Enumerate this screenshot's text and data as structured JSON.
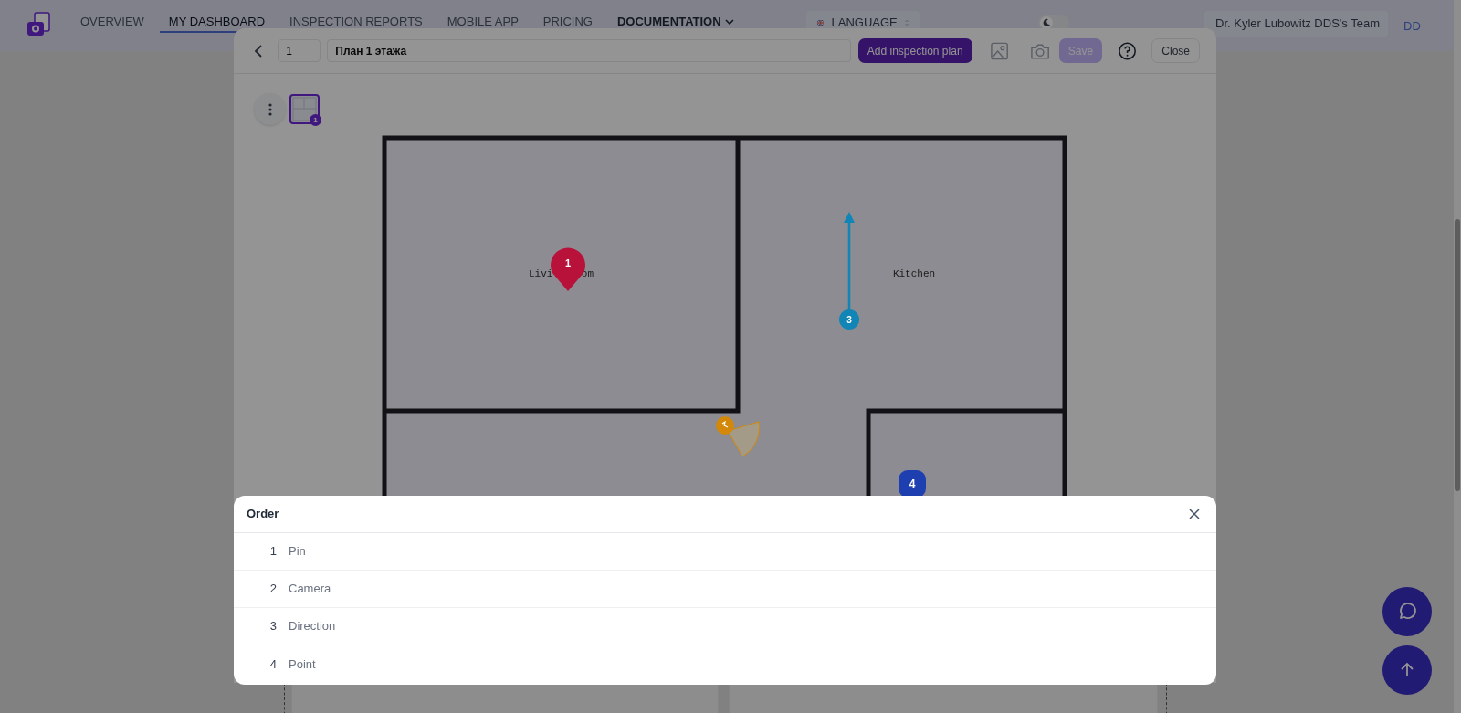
{
  "nav": {
    "items": [
      {
        "label": "OVERVIEW",
        "selected": false,
        "dropdown": false
      },
      {
        "label": "MY DASHBOARD",
        "selected": true,
        "dropdown": false
      },
      {
        "label": "INSPECTION REPORTS",
        "selected": false,
        "dropdown": false
      },
      {
        "label": "MOBILE APP",
        "selected": false,
        "dropdown": false
      },
      {
        "label": "PRICING",
        "selected": false,
        "dropdown": false
      },
      {
        "label": "DOCUMENTATION",
        "selected": false,
        "dropdown": true
      }
    ],
    "language": "LANGUAGE",
    "dark_mode": false,
    "team": "Dr. Kyler Lubowitz DDS's Team",
    "avatar": "DD"
  },
  "plan_editor": {
    "number": "1",
    "title": "План 1 этажа",
    "add_button": "Add inspection plan",
    "save_button": {
      "label": "Save",
      "disabled": true
    },
    "close_button": "Close",
    "thumbnails": [
      {
        "badge": "1",
        "selected": true
      }
    ],
    "rooms": [
      {
        "label_parts": [
          "Livi",
          "om"
        ]
      },
      {
        "label_parts": [
          "Kitchen"
        ]
      }
    ],
    "markers": [
      {
        "kind": "pin",
        "number": "1",
        "color": "#b8123a"
      },
      {
        "kind": "camera",
        "color": "#d4880a"
      },
      {
        "kind": "direction",
        "number": "3",
        "color": "#1185b5"
      },
      {
        "kind": "point",
        "number": "4",
        "color": "#1d3fb0"
      }
    ]
  },
  "order_panel": {
    "title": "Order",
    "items": [
      {
        "number": "1",
        "label": "Pin"
      },
      {
        "number": "2",
        "label": "Camera"
      },
      {
        "number": "3",
        "label": "Direction"
      },
      {
        "number": "4",
        "label": "Point"
      }
    ]
  }
}
